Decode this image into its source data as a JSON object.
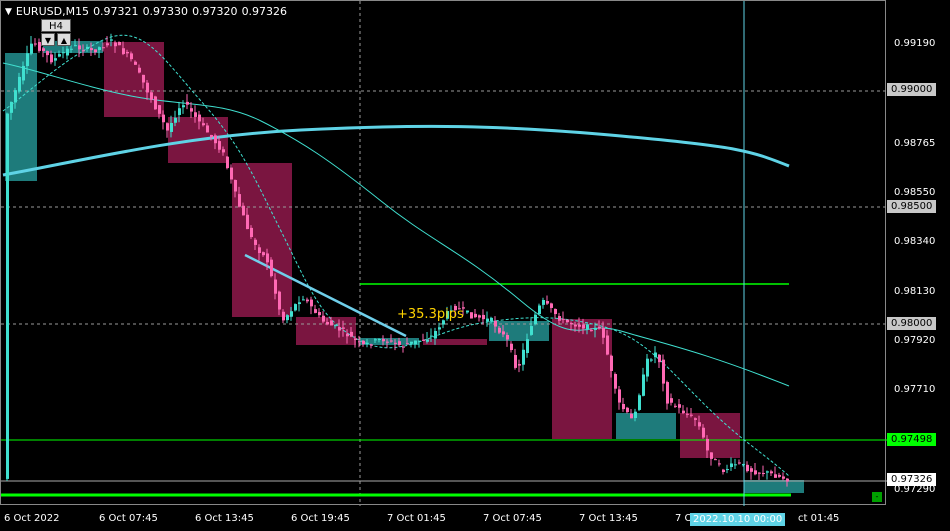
{
  "symbol_bar": {
    "symbol": "EURUSD,M15",
    "open": "0.97321",
    "high": "0.97330",
    "low": "0.97320",
    "close": "0.97326",
    "menu_icon": "triangle-down-icon"
  },
  "timeframe_badge": {
    "label": "H4",
    "down_icon": "▼",
    "up_icon": "▲"
  },
  "annotation": {
    "pips": "+35.3pips"
  },
  "price_axis": {
    "ticks": [
      "0.99190",
      "0.98765",
      "0.98550",
      "0.98340",
      "0.98130",
      "0.97920",
      "0.97710",
      "0.97290"
    ],
    "tags": {
      "level_99000": "0.99000",
      "level_98500": "0.98500",
      "level_98000": "0.98000",
      "level_97498": "0.97498",
      "current_price": "0.97326"
    }
  },
  "time_axis": {
    "ticks": [
      "6 Oct 2022",
      "6 Oct 07:45",
      "6 Oct 13:45",
      "6 Oct 19:45",
      "7 Oct 01:45",
      "7 Oct 07:45",
      "7 Oct 13:45",
      "7 O",
      "ct 01:45"
    ],
    "cursor_label": "2022.10.10 00:00"
  },
  "corner_button": "-",
  "colors": {
    "background": "#000000",
    "bull_candle": "#40e0d0",
    "bear_candle": "#ff69b4",
    "h4_bull_box": "#1e7b7b",
    "h4_bear_box": "#7a1540",
    "ma_fast": "#40e0d0",
    "ma_slow": "#5fd3e6",
    "level_lines": "#00ff00",
    "trend_line": "#6fcfea",
    "pips_text": "#ffd300"
  }
}
